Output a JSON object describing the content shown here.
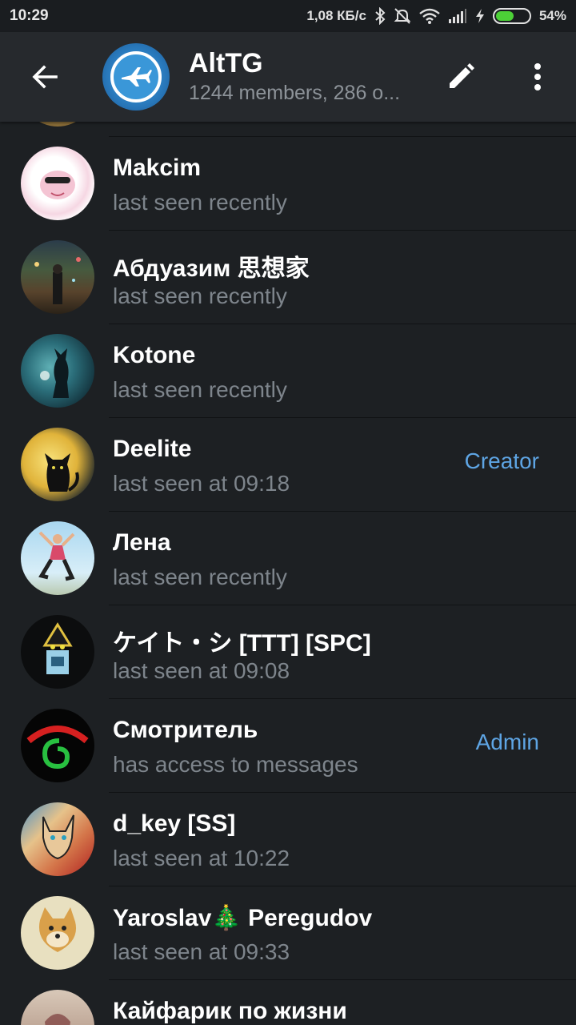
{
  "status_bar": {
    "time": "10:29",
    "network_speed": "1,08 КБ/с",
    "battery_percent": "54%",
    "battery_level": 0.54,
    "icons": [
      "bluetooth-icon",
      "mute-icon",
      "wifi-icon",
      "signal-icon",
      "charging-icon",
      "battery-icon"
    ]
  },
  "header": {
    "title": "AltTG",
    "subtitle": "1244 members, 286 o...",
    "icons": [
      "back-arrow-icon",
      "pencil-icon",
      "more-vertical-icon"
    ]
  },
  "members": [
    {
      "name": "Makcim",
      "status": "last seen recently",
      "role": ""
    },
    {
      "name": "Абдуазим 思想家",
      "status": "last seen recently",
      "role": ""
    },
    {
      "name": "Kotone",
      "status": "last seen recently",
      "role": ""
    },
    {
      "name": "Deelite",
      "status": "last seen at 09:18",
      "role": "Creator"
    },
    {
      "name": "Лена",
      "status": "last seen recently",
      "role": ""
    },
    {
      "name": "ケイト・シ [TTT] [SPC]",
      "status": "last seen at 09:08",
      "role": ""
    },
    {
      "name": "Смотритель",
      "status": "has access to messages",
      "role": "Admin"
    },
    {
      "name": "d_key [SS]",
      "status": "last seen at 10:22",
      "role": ""
    },
    {
      "name": "Yaroslav🎄 Peregudov",
      "status": "last seen at 09:33",
      "role": ""
    },
    {
      "name": "Кайфарик по жизни",
      "status": "",
      "role": ""
    }
  ],
  "colors": {
    "background": "#1d2023",
    "appbar": "#26292d",
    "accent": "#5ea5e4",
    "secondary_text": "#7e858c"
  }
}
